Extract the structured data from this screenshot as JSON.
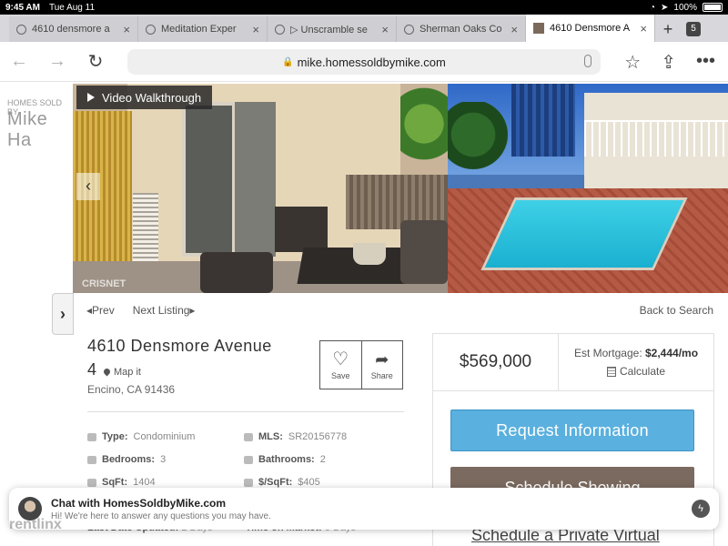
{
  "status": {
    "time": "9:45 AM",
    "date": "Tue Aug 11",
    "battery": "100%"
  },
  "tabs": [
    {
      "title": "4610 densmore a",
      "active": false
    },
    {
      "title": "Meditation Exper",
      "active": false
    },
    {
      "title": "▷ Unscramble se",
      "active": false
    },
    {
      "title": "Sherman Oaks Co",
      "active": false
    },
    {
      "title": "4610 Densmore A",
      "active": true
    }
  ],
  "tab_count": "5",
  "url": "mike.homessoldbymike.com",
  "brand": {
    "small": "HOMES SOLD BY",
    "big": "Mike Ha"
  },
  "gallery": {
    "video_label": "Video Walkthrough",
    "watermark": "CRISNET"
  },
  "nav": {
    "prev": "Prev",
    "next": "Next Listing",
    "back": "Back to Search"
  },
  "listing": {
    "street": "4610 Densmore Avenue",
    "unit": "4",
    "map_it": "Map it",
    "city": "Encino, CA 91436",
    "save": "Save",
    "share": "Share",
    "price": "$569,000",
    "mortgage_label": "Est Mortgage:",
    "mortgage_value": "$2,444/mo",
    "calculate": "Calculate",
    "request_btn": "Request Information",
    "schedule_btn": "Schedule Showing",
    "virtual_link": "Schedule a Private Virtual"
  },
  "specs": [
    {
      "label": "Type:",
      "value": "Condominium"
    },
    {
      "label": "MLS:",
      "value": "SR20156778"
    },
    {
      "label": "Bedrooms:",
      "value": "3"
    },
    {
      "label": "Bathrooms:",
      "value": "2"
    },
    {
      "label": "SqFt:",
      "value": "1404"
    },
    {
      "label": "$/SqFt:",
      "value": "$405"
    }
  ],
  "lastrow": [
    {
      "label": "Last Date Updated:",
      "value": "2 Days"
    },
    {
      "label": "Time on Market:",
      "value": "8 Days"
    }
  ],
  "chat": {
    "title": "Chat with HomesSoldbyMike.com",
    "subtitle": "Hi! We're here to answer any questions you may have."
  },
  "rentlinx": "rentlinx"
}
